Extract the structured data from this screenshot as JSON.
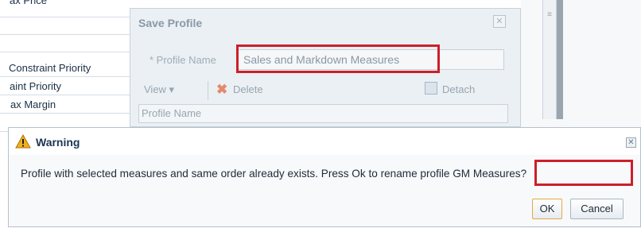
{
  "background_list": {
    "rows": [
      {
        "label": "ax Price"
      },
      {
        "label": ""
      },
      {
        "label": ""
      },
      {
        "label": "Constraint Priority"
      },
      {
        "label": "aint Priority"
      },
      {
        "label": "ax Margin"
      },
      {
        "label": ""
      }
    ]
  },
  "save_profile": {
    "title": "Save Profile",
    "profile_name_label": "* Profile Name",
    "profile_name_value": "Sales and Markdown Measures",
    "toolbar": {
      "view_label": "View ▾",
      "delete_label": "Delete",
      "detach_label": "Detach"
    },
    "grid_header": "Profile Name"
  },
  "warning": {
    "title": "Warning",
    "message": "Profile with selected measures and same order already exists. Press Ok to rename profile GM Measures?",
    "ok_label": "OK",
    "cancel_label": "Cancel"
  },
  "colors": {
    "highlight": "#cc1f2a",
    "warning_icon": "#f2b01e"
  }
}
